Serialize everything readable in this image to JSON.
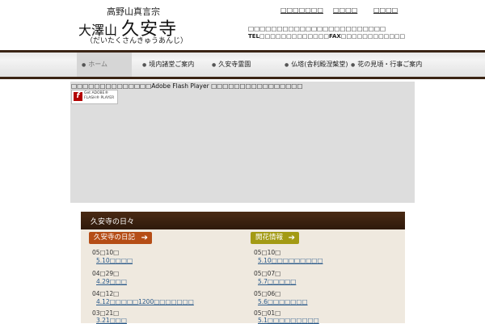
{
  "header": {
    "sect": "高野山真言宗",
    "name_prefix": "大澤山",
    "name_main": "久安寺",
    "reading": "（だいたくさんきゅうあんじ）",
    "top_links": [
      "□□□□□□□",
      "□□□□",
      "□□□□"
    ],
    "contact_line1": "□□□□□□□□□□□□□□□□□□□□□□□□",
    "contact_line2": "TEL□□□□□□□□□□□□□FAX□□□□□□□□□□□□"
  },
  "nav": {
    "items": [
      "ホーム",
      "境内諸堂ご案内",
      "久安寺霊園",
      "仏塔(舎利殿涅槃堂)",
      "花の見頃・行事ご案内"
    ]
  },
  "flash": {
    "message": "□□□□□□□□□□□□□□Adobe Flash Player □□□□□□□□□□□□□□□□",
    "badge_line1": "Get ADOBE®",
    "badge_line2": "FLASH® PLAYER",
    "badge_letter": "f"
  },
  "panel": {
    "title": "久安寺の日々",
    "diary": {
      "button": "久安寺の日記",
      "entries": [
        {
          "date": "05□10□",
          "link": "5.10□□□□"
        },
        {
          "date": "04□29□",
          "link": "4.29□□□"
        },
        {
          "date": "04□12□",
          "link": "4.12□□□□□1200□□□□□□□"
        },
        {
          "date": "03□21□",
          "link": "3.21□□□"
        }
      ]
    },
    "bloom": {
      "button": "開花情報",
      "entries": [
        {
          "date": "05□10□",
          "link": "5.10□□□□□□□□□"
        },
        {
          "date": "05□07□",
          "link": "5.7□□□□□"
        },
        {
          "date": "05□06□",
          "link": "5.6□□□□□□□"
        },
        {
          "date": "05□01□",
          "link": "5.1□□□□□□□□□"
        }
      ]
    }
  },
  "colors": {
    "nav_border": "#3a2414",
    "diary_button": "#b54d16",
    "bloom_button": "#a39a14",
    "link": "#2a5a8a"
  }
}
